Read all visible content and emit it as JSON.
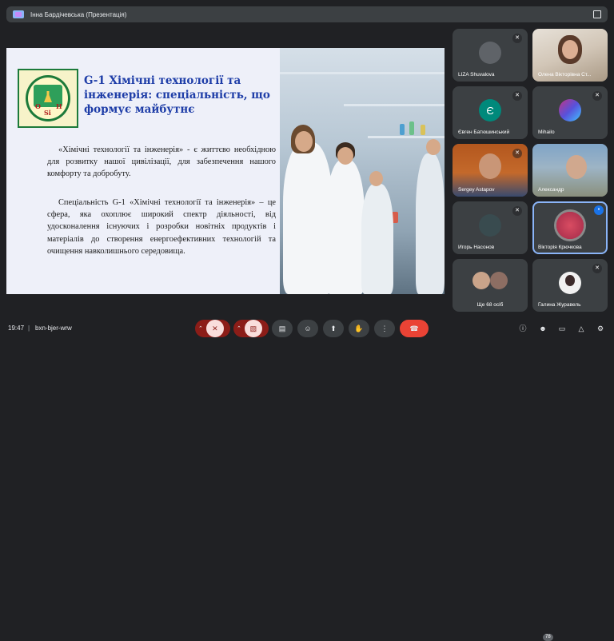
{
  "window": {
    "presentation_title": "Інна Бардічевська (Презентація)",
    "icons": [
      "presentation-icon",
      "fullscreen-icon"
    ]
  },
  "slide": {
    "title": "G-1 Хімічні технології та інженерія: спеціальність, що формує майбутнє",
    "paragraph1": "«Хімічні технології та інженерія» - є життєво необхідною для розвитку нашої цивілізації, для забезпечення нашого комфорту та добробуту.",
    "paragraph2": "Спеціальність G-1 «Хімічні технології та інженерія» – це сфера, яка охоплює широкий спектр діяльності, від удосконалення існуючих і розробки новітніх продуктів і матеріалів до створення енергоефективних технологій та очищення навколишнього середовища.",
    "logo_letters": [
      "O",
      "Si",
      "H"
    ],
    "title_color": "#1f3ea8"
  },
  "participants": [
    {
      "name": "LIZA Shuvalova",
      "muted": true
    },
    {
      "name": "Олена Вікторівна Ст...",
      "muted": false
    },
    {
      "name": "Євген Батюшинський",
      "muted": true,
      "initial": "Є",
      "avatar_color": "#00897b"
    },
    {
      "name": "Mihailo",
      "muted": true
    },
    {
      "name": "Sergey Astapov",
      "muted": true
    },
    {
      "name": "Александр",
      "muted": false
    },
    {
      "name": "Игорь Насонов",
      "muted": true
    },
    {
      "name": "Вікторія Крючкова",
      "muted": false,
      "speaking": true
    },
    {
      "name": "Ще 68 осіб",
      "muted": false
    },
    {
      "name": "Галина Журавель",
      "muted": true
    }
  ],
  "bottombar": {
    "time": "19:47",
    "separator": "|",
    "meeting_code": "bxn-bjer-wrw",
    "participant_count": "78",
    "accent_red": "#ea4335"
  }
}
